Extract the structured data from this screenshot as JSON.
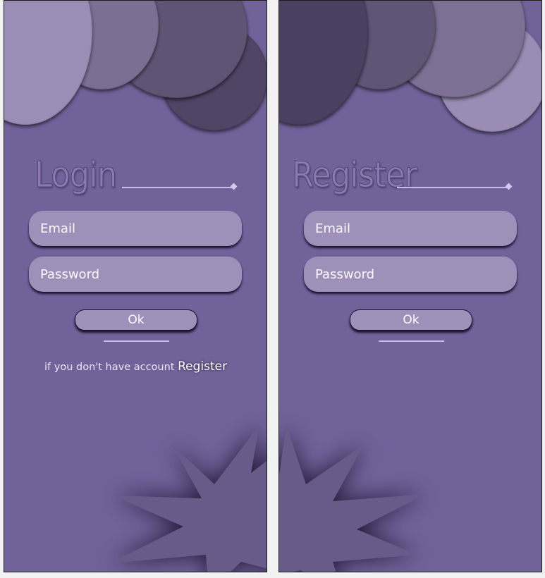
{
  "colors": {
    "background": "#71629a",
    "field": "#9e90b8",
    "field_text": "#fbfaff",
    "accent_line": "#cdbae8",
    "title_fill": "#8b79b0"
  },
  "login": {
    "title": "Login",
    "email_placeholder": "Email",
    "password_placeholder": "Password",
    "ok_label": "Ok",
    "footer_prefix": "if you don't have account",
    "footer_link": "Register"
  },
  "register": {
    "title": "Register",
    "email_placeholder": "Email",
    "password_placeholder": "Password",
    "ok_label": "Ok"
  }
}
